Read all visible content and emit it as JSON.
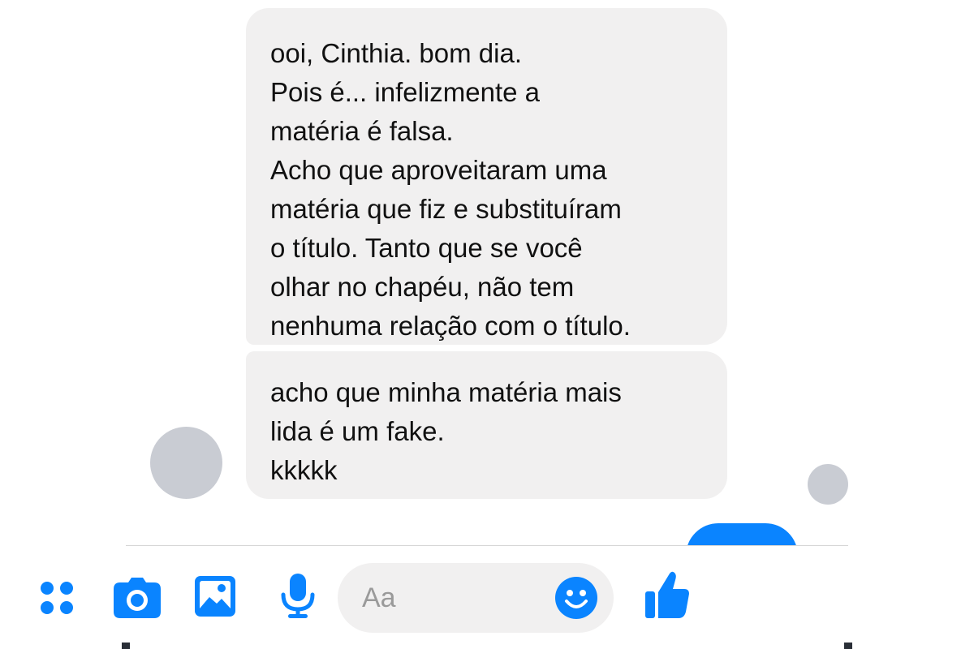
{
  "conversation": {
    "messages": [
      {
        "text": "ooi, Cinthia. bom dia.\nPois é... infelizmente a\nmatéria é falsa.\nAcho que aproveitaram uma\nmatéria que fiz e substituíram\no título. Tanto que se você\nolhar no chapéu, não tem\nnenhuma relação com o título."
      },
      {
        "text": "acho que minha matéria mais\nlida é um fake.\nkkkkk"
      }
    ]
  },
  "composer": {
    "placeholder": "Aa",
    "icons": [
      "more-icon",
      "camera-icon",
      "photo-icon",
      "microphone-icon",
      "emoji-icon",
      "like-icon"
    ]
  },
  "colors": {
    "accent": "#0A84FF",
    "incoming_bubble": "#F1F0F0",
    "avatar_placeholder": "#C9CCD3"
  }
}
